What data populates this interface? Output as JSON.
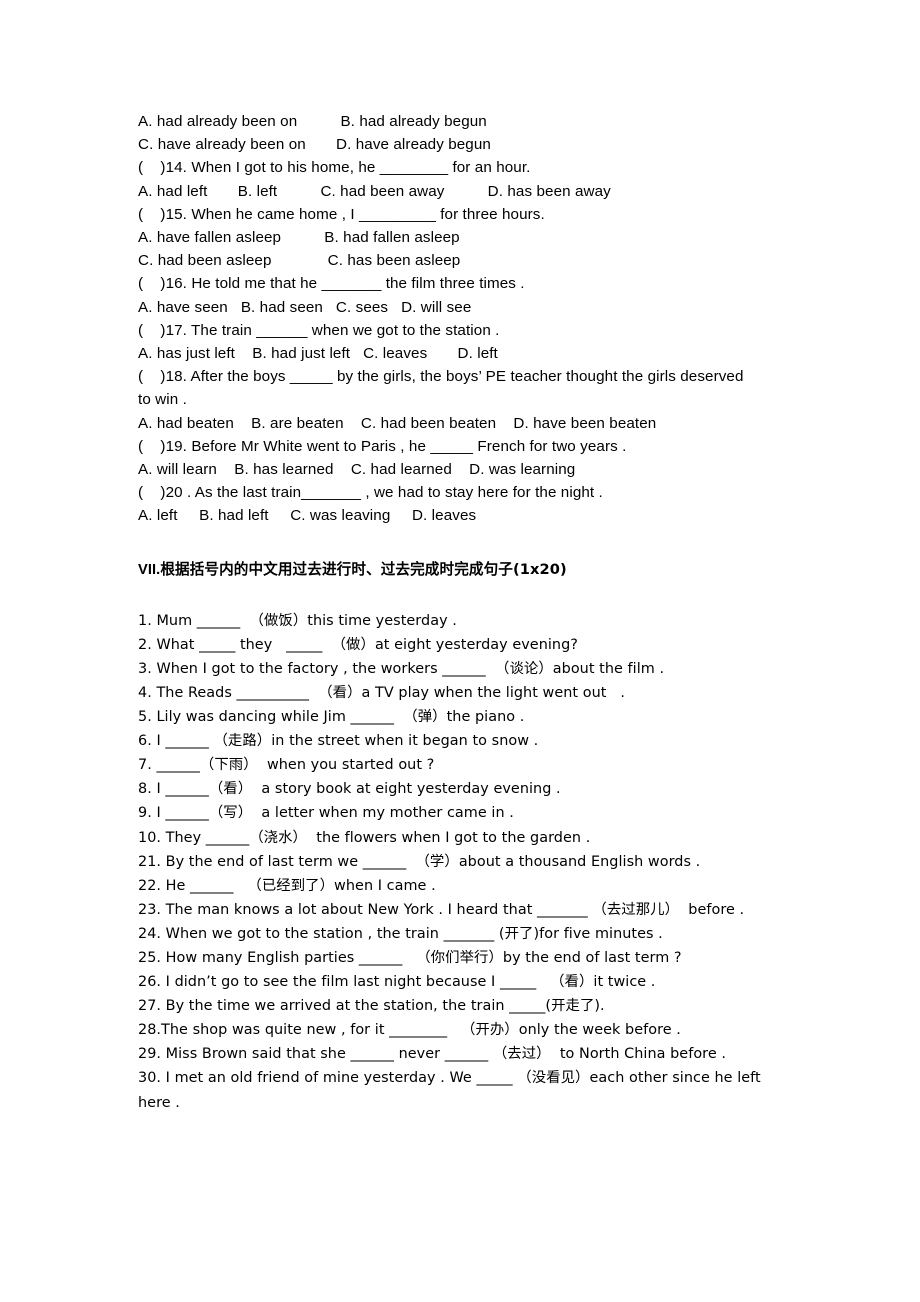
{
  "document": {
    "multiple_choice_block": [
      "A. had already been on          B. had already begun",
      "C. have already been on       D. have already begun",
      "(    )14. When I got to his home, he ________ for an hour.",
      "A. had left       B. left          C. had been away          D. has been away",
      "(    )15. When he came home , I _________ for three hours.",
      "A. have fallen asleep          B. had fallen asleep",
      "C. had been asleep             C. has been asleep",
      "(    )16. He told me that he _______ the film three times .",
      "A. have seen   B. had seen   C. sees   D. will see",
      "(    )17. The train ______ when we got to the station .",
      "A. has just left    B. had just left   C. leaves       D. left",
      "(    )18. After the boys _____ by the girls, the boys’ PE teacher thought the girls deserved",
      "to win .",
      "A. had beaten    B. are beaten    C. had been beaten    D. have been beaten",
      "(    )19. Before Mr White went to Paris , he _____ French for two years .",
      "A. will learn    B. has learned    C. had learned    D. was learning",
      "(    )20 . As the last train_______ , we had to stay here for the night .",
      "A. left     B. had left     C. was leaving     D. leaves"
    ],
    "section_heading": {
      "number": "VII.",
      "text": "根据括号内的中文用过去进行时、过去完成时完成句子(1x20)"
    },
    "fill_in_items": [
      "1. Mum ______  （做饭）this time yesterday .",
      "2. What _____ they   _____  （做）at eight yesterday evening?",
      "3. When I got to the factory , the workers ______  （谈论）about the film .",
      "4. The Reads __________  （看）a TV play when the light went out   .",
      "5. Lily was dancing while Jim ______  （弹）the piano .",
      "6. I ______ （走路）in the street when it began to snow .",
      "7. ______（下雨）  when you started out ?",
      "8. I ______（看）  a story book at eight yesterday evening .",
      "9. I ______（写）  a letter when my mother came in .",
      "10. They ______（浇水）  the flowers when I got to the garden .",
      "21. By the end of last term we ______  （学）about a thousand English words .",
      "22. He ______   （已经到了）when I came .",
      "23. The man knows a lot about New York . I heard that _______ （去过那儿）  before .",
      "24. When we got to the station , the train _______ (开了)for five minutes .",
      "25. How many English parties ______   （你们举行）by the end of last term ?",
      "26. I didn’t go to see the film last night because I _____   （看）it twice .",
      "27. By the time we arrived at the station, the train _____(开走了).",
      "28.The shop was quite new , for it ________   （开办）only the week before .",
      "29. Miss Brown said that she ______ never ______ （去过）  to North China before .",
      "30. I met an old friend of mine yesterday . We _____ （没看见）each other since he left",
      "here ."
    ]
  }
}
